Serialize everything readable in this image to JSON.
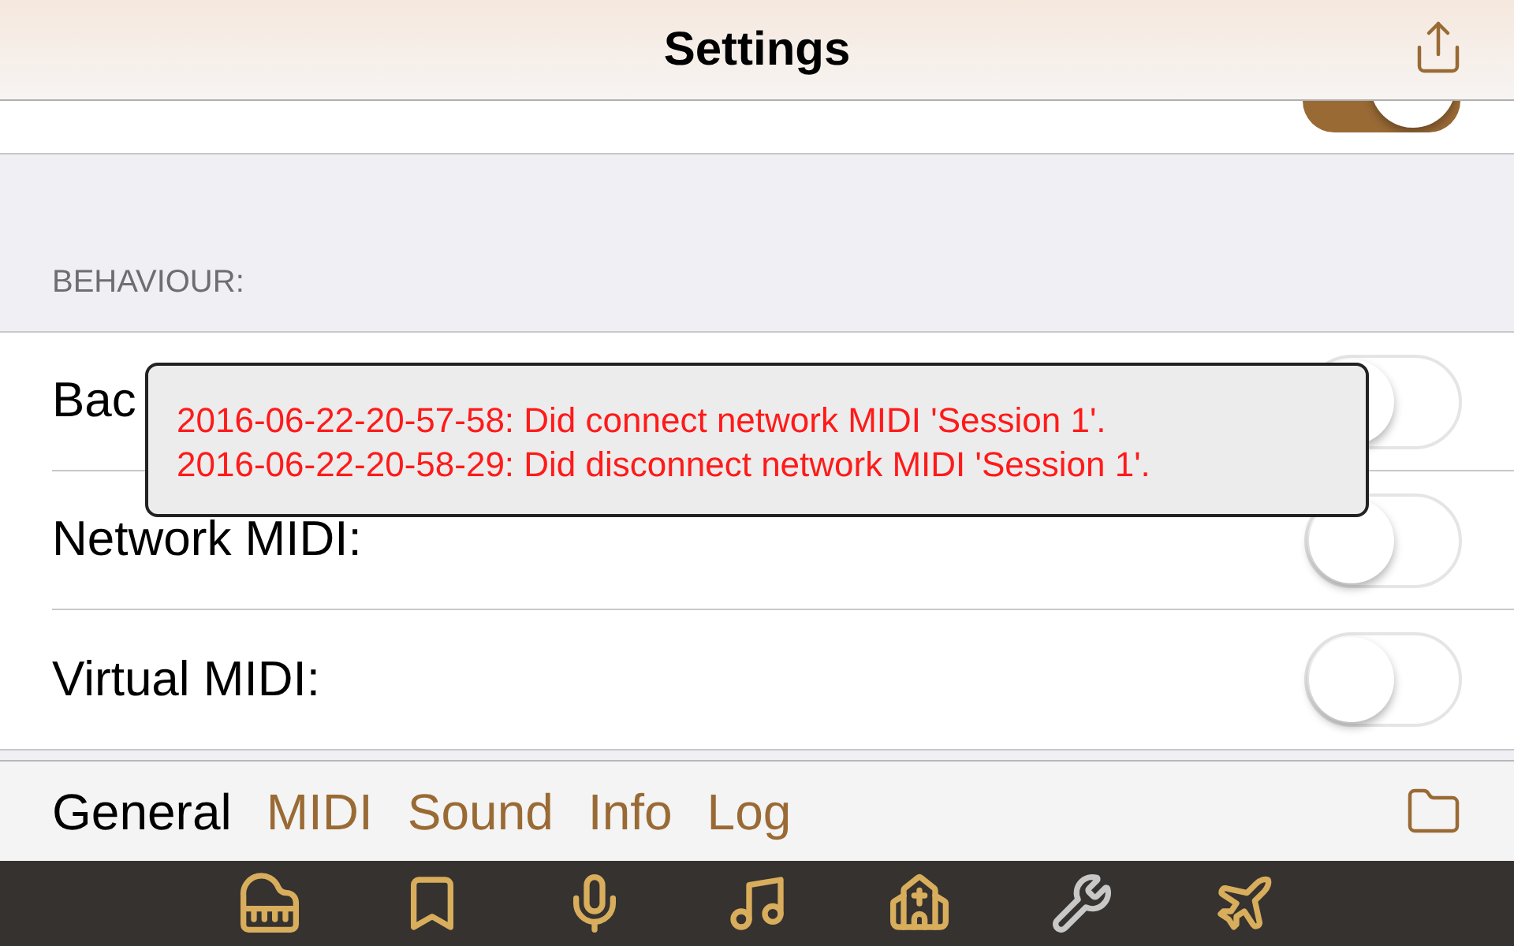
{
  "nav": {
    "title": "Settings"
  },
  "top_row": {
    "on": true
  },
  "section": {
    "header": "BEHAVIOUR:"
  },
  "rows": [
    {
      "label": "Bac",
      "on": false
    },
    {
      "label": "Network MIDI:",
      "on": false
    },
    {
      "label": "Virtual MIDI:",
      "on": false
    }
  ],
  "log_popup": {
    "lines": [
      "2016-06-22-20-57-58: Did connect network MIDI 'Session 1'.",
      "2016-06-22-20-58-29: Did disconnect network MIDI 'Session 1'."
    ]
  },
  "tabs": [
    {
      "label": "General",
      "selected": true
    },
    {
      "label": "MIDI",
      "selected": false
    },
    {
      "label": "Sound",
      "selected": false
    },
    {
      "label": "Info",
      "selected": false
    },
    {
      "label": "Log",
      "selected": false
    }
  ],
  "toolbar": [
    {
      "kind": "piano",
      "selected": false
    },
    {
      "kind": "bookmark",
      "selected": false
    },
    {
      "kind": "mic",
      "selected": false
    },
    {
      "kind": "music",
      "selected": false
    },
    {
      "kind": "church",
      "selected": false
    },
    {
      "kind": "tools",
      "selected": true
    },
    {
      "kind": "plane",
      "selected": false
    }
  ]
}
